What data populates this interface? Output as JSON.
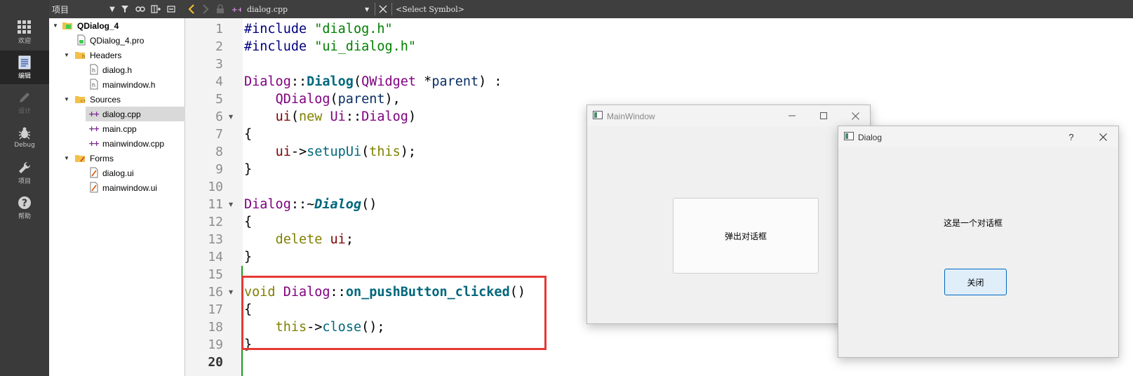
{
  "modes": [
    {
      "label": "欢迎",
      "icon": "grid-icon",
      "state": "normal"
    },
    {
      "label": "编辑",
      "icon": "document-icon",
      "state": "active"
    },
    {
      "label": "设计",
      "icon": "pencil-icon",
      "state": "disabled"
    },
    {
      "label": "Debug",
      "icon": "bug-icon",
      "state": "normal"
    },
    {
      "label": "项目",
      "icon": "wrench-icon",
      "state": "normal"
    },
    {
      "label": "帮助",
      "icon": "help-icon",
      "state": "normal"
    }
  ],
  "project_pane": {
    "title": "项目",
    "tree": [
      {
        "label": "QDialog_4",
        "icon": "qt-project-icon",
        "expanded": true,
        "bold": true,
        "depth": 0
      },
      {
        "label": "QDialog_4.pro",
        "icon": "pro-file-icon",
        "depth": 1
      },
      {
        "label": "Headers",
        "icon": "folder-h-icon",
        "expanded": true,
        "depth": 1
      },
      {
        "label": "dialog.h",
        "icon": "header-file-icon",
        "depth": 2
      },
      {
        "label": "mainwindow.h",
        "icon": "header-file-icon",
        "depth": 2
      },
      {
        "label": "Sources",
        "icon": "folder-cpp-icon",
        "expanded": true,
        "depth": 1
      },
      {
        "label": "dialog.cpp",
        "icon": "cpp-file-icon",
        "depth": 2,
        "selected": true
      },
      {
        "label": "main.cpp",
        "icon": "cpp-file-icon",
        "depth": 2
      },
      {
        "label": "mainwindow.cpp",
        "icon": "cpp-file-icon",
        "depth": 2
      },
      {
        "label": "Forms",
        "icon": "folder-ui-icon",
        "expanded": true,
        "depth": 1
      },
      {
        "label": "dialog.ui",
        "icon": "ui-file-icon",
        "depth": 2
      },
      {
        "label": "mainwindow.ui",
        "icon": "ui-file-icon",
        "depth": 2
      }
    ]
  },
  "editor_toolbar": {
    "file_name": "dialog.cpp",
    "symbol": "<Select Symbol>"
  },
  "editor": {
    "current_line": "20",
    "lines": [
      {
        "n": "1",
        "tokens": [
          [
            "pp",
            "#include "
          ],
          [
            "str",
            "\"dialog.h\""
          ]
        ]
      },
      {
        "n": "2",
        "tokens": [
          [
            "pp",
            "#include "
          ],
          [
            "str",
            "\"ui_dialog.h\""
          ]
        ]
      },
      {
        "n": "3",
        "tokens": []
      },
      {
        "n": "4",
        "tokens": [
          [
            "cls",
            "Dialog"
          ],
          [
            "",
            "::"
          ],
          [
            "fnb",
            "Dialog"
          ],
          [
            "",
            "("
          ],
          [
            "cls",
            "QWidget"
          ],
          [
            "",
            " *"
          ],
          [
            "par",
            "parent"
          ],
          [
            "",
            ") :"
          ]
        ]
      },
      {
        "n": "5",
        "tokens": [
          [
            "",
            "    "
          ],
          [
            "cls",
            "QDialog"
          ],
          [
            "",
            "("
          ],
          [
            "par",
            "parent"
          ],
          [
            "",
            "),"
          ]
        ]
      },
      {
        "n": "6",
        "fold": true,
        "tokens": [
          [
            "",
            "    "
          ],
          [
            "mem",
            "ui"
          ],
          [
            "",
            "("
          ],
          [
            "kw",
            "new "
          ],
          [
            "cls",
            "Ui"
          ],
          [
            "",
            "::"
          ],
          [
            "cls",
            "Dialog"
          ],
          [
            "",
            ")"
          ]
        ]
      },
      {
        "n": "7",
        "tokens": [
          [
            "",
            "{"
          ]
        ]
      },
      {
        "n": "8",
        "tokens": [
          [
            "",
            "    "
          ],
          [
            "mem",
            "ui"
          ],
          [
            "",
            "->"
          ],
          [
            "fn",
            "setupUi"
          ],
          [
            "",
            "("
          ],
          [
            "kw",
            "this"
          ],
          [
            "",
            ");"
          ]
        ]
      },
      {
        "n": "9",
        "tokens": [
          [
            "",
            "}"
          ]
        ]
      },
      {
        "n": "10",
        "tokens": []
      },
      {
        "n": "11",
        "fold": true,
        "tokens": [
          [
            "cls",
            "Dialog"
          ],
          [
            "",
            "::~"
          ],
          [
            "fnbi",
            "Dialog"
          ],
          [
            "",
            "()"
          ]
        ]
      },
      {
        "n": "12",
        "tokens": [
          [
            "",
            "{"
          ]
        ]
      },
      {
        "n": "13",
        "tokens": [
          [
            "",
            "    "
          ],
          [
            "kw",
            "delete "
          ],
          [
            "mem",
            "ui"
          ],
          [
            "",
            ";"
          ]
        ]
      },
      {
        "n": "14",
        "tokens": [
          [
            "",
            "}"
          ]
        ]
      },
      {
        "n": "15",
        "tokens": []
      },
      {
        "n": "16",
        "fold": true,
        "tokens": [
          [
            "kw",
            "void "
          ],
          [
            "cls",
            "Dialog"
          ],
          [
            "",
            "::"
          ],
          [
            "fnb",
            "on_pushButton_clicked"
          ],
          [
            "",
            "()"
          ]
        ]
      },
      {
        "n": "17",
        "tokens": [
          [
            "",
            "{"
          ]
        ]
      },
      {
        "n": "18",
        "tokens": [
          [
            "",
            "    "
          ],
          [
            "kw",
            "this"
          ],
          [
            "",
            "->"
          ],
          [
            "fn",
            "close"
          ],
          [
            "",
            "();"
          ]
        ]
      },
      {
        "n": "19",
        "tokens": [
          [
            "",
            "}"
          ]
        ]
      },
      {
        "n": "20",
        "tokens": []
      }
    ]
  },
  "main_window": {
    "title": "MainWindow",
    "button_label": "弹出对话框"
  },
  "dialog_window": {
    "title": "Dialog",
    "help_label": "?",
    "message": "这是一个对话框",
    "close_button_label": "关闭"
  },
  "colors": {
    "highlight_box": "#e53935",
    "change_bar": "#1a9c1a",
    "mode_bar": "#3a3a3a"
  }
}
